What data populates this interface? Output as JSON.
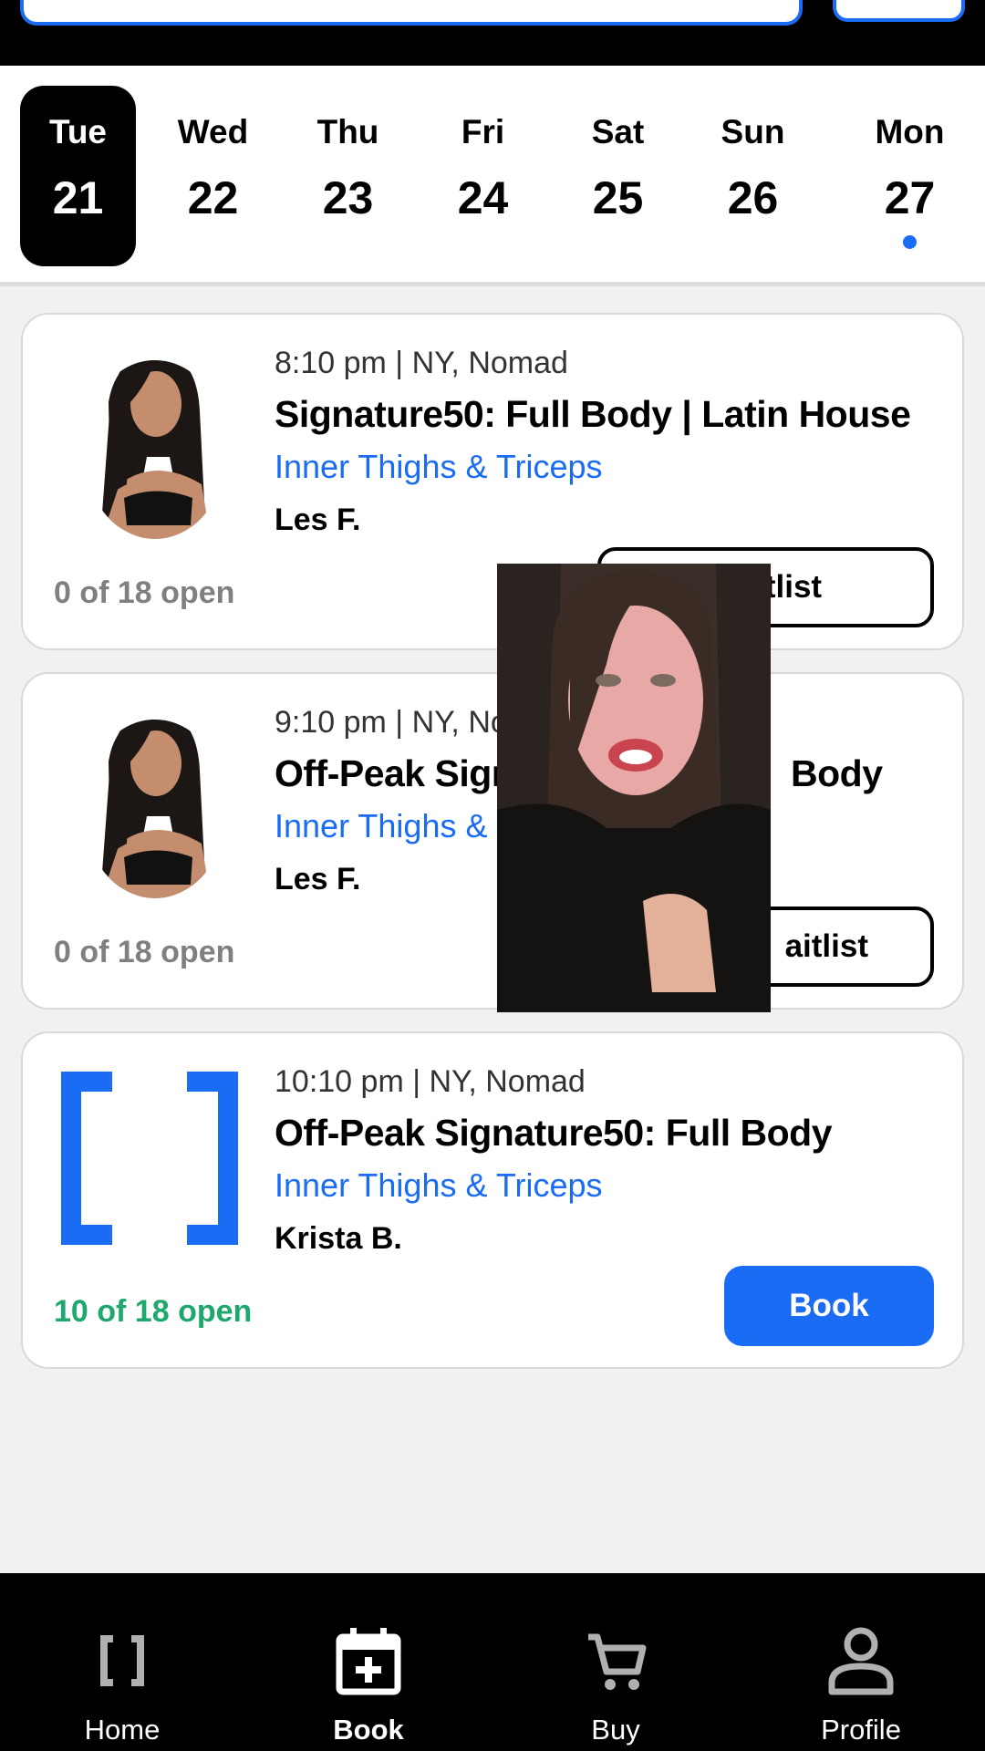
{
  "days": [
    {
      "name": "Tue",
      "num": "21",
      "selected": true,
      "dot": false
    },
    {
      "name": "Wed",
      "num": "22",
      "selected": false,
      "dot": false
    },
    {
      "name": "Thu",
      "num": "23",
      "selected": false,
      "dot": false
    },
    {
      "name": "Fri",
      "num": "24",
      "selected": false,
      "dot": false
    },
    {
      "name": "Sat",
      "num": "25",
      "selected": false,
      "dot": false
    },
    {
      "name": "Sun",
      "num": "26",
      "selected": false,
      "dot": false
    },
    {
      "name": "Mon",
      "num": "27",
      "selected": false,
      "dot": true
    }
  ],
  "classes": [
    {
      "meta": "8:10 pm | NY, Nomad",
      "title": "Signature50: Full Body | Latin House",
      "focus": "Inner Thighs & Triceps",
      "coach": "Les F.",
      "spots": "0 of 18 open",
      "action": "Waitlist"
    },
    {
      "meta": "9:10 pm | NY, Nom",
      "title": "Off-Peak Signa",
      "title_tail": "Body",
      "focus": "Inner Thighs &",
      "coach": "Les F.",
      "spots": "0 of 18 open",
      "action": "aitlist"
    },
    {
      "meta": "10:10 pm | NY, Nomad",
      "title": "Off-Peak Signature50: Full Body",
      "focus": "Inner Thighs & Triceps",
      "coach": "Krista B.",
      "spots": "10 of 18 open",
      "action": "Book"
    }
  ],
  "nav": {
    "home": "Home",
    "book": "Book",
    "buy": "Buy",
    "profile": "Profile"
  },
  "colors": {
    "accent": "#1a6cf5",
    "available": "#1fa86e",
    "full": "#808080"
  }
}
